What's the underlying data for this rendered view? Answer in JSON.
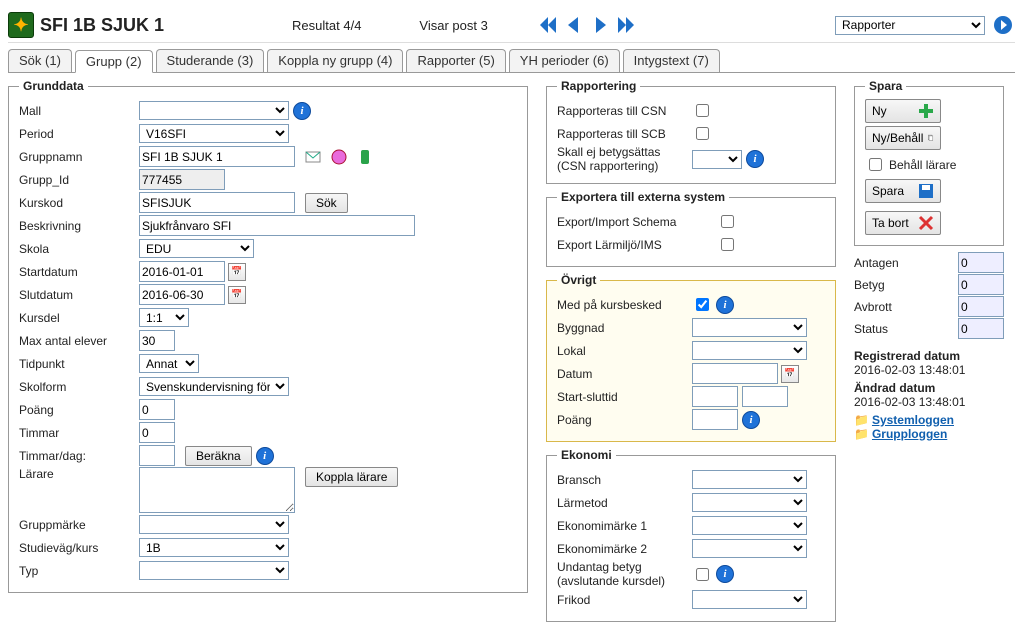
{
  "header": {
    "title": "SFI 1B SJUK 1",
    "result": "Resultat 4/4",
    "view_post": "Visar post 3",
    "report_select": "Rapporter"
  },
  "tabs": [
    {
      "label": "Sök (1)",
      "active": false
    },
    {
      "label": "Grupp (2)",
      "active": true
    },
    {
      "label": "Studerande (3)",
      "active": false
    },
    {
      "label": "Koppla ny grupp (4)",
      "active": false
    },
    {
      "label": "Rapporter (5)",
      "active": false
    },
    {
      "label": "YH perioder (6)",
      "active": false
    },
    {
      "label": "Intygstext (7)",
      "active": false
    }
  ],
  "grunddata": {
    "legend": "Grunddata",
    "mall_label": "Mall",
    "mall_value": "",
    "period_label": "Period",
    "period_value": "V16SFI",
    "gruppnamn_label": "Gruppnamn",
    "gruppnamn_value": "SFI 1B SJUK 1",
    "gruppid_label": "Grupp_Id",
    "gruppid_value": "777455",
    "kurskod_label": "Kurskod",
    "kurskod_value": "SFISJUK",
    "sok_label": "Sök",
    "beskrivning_label": "Beskrivning",
    "beskrivning_value": "Sjukfrånvaro SFI",
    "skola_label": "Skola",
    "skola_value": "EDU",
    "startdatum_label": "Startdatum",
    "startdatum_value": "2016-01-01",
    "slutdatum_label": "Slutdatum",
    "slutdatum_value": "2016-06-30",
    "kursdel_label": "Kursdel",
    "kursdel_value": "1:1",
    "maxantal_label": "Max antal elever",
    "maxantal_value": "30",
    "tidpunkt_label": "Tidpunkt",
    "tidpunkt_value": "Annat",
    "skolform_label": "Skolform",
    "skolform_value": "Svenskundervisning för in",
    "poang_label": "Poäng",
    "poang_value": "0",
    "timmar_label": "Timmar",
    "timmar_value": "0",
    "timmardag_label": "Timmar/dag:",
    "timmardag_value": "",
    "berakna_label": "Beräkna",
    "larare_label": "Lärare",
    "koppla_larare_label": "Koppla lärare",
    "gruppmarke_label": "Gruppmärke",
    "gruppmarke_value": "",
    "studievag_label": "Studieväg/kurs",
    "studievag_value": "1B",
    "typ_label": "Typ",
    "typ_value": ""
  },
  "rapportering": {
    "legend": "Rapportering",
    "csn_label": "Rapporteras till CSN",
    "scb_label": "Rapporteras till SCB",
    "betyg_label1": "Skall ej betygsättas",
    "betyg_label2": "(CSN rapportering)"
  },
  "exportera": {
    "legend": "Exportera till externa system",
    "schema_label": "Export/Import Schema",
    "larmiljo_label": "Export Lärmiljö/IMS"
  },
  "ovrigt": {
    "legend": "Övrigt",
    "kursbesked_label": "Med på kursbesked",
    "byggnad_label": "Byggnad",
    "lokal_label": "Lokal",
    "datum_label": "Datum",
    "startslut_label": "Start-sluttid",
    "poang_label": "Poäng"
  },
  "ekonomi": {
    "legend": "Ekonomi",
    "bransch_label": "Bransch",
    "larmetod_label": "Lärmetod",
    "em1_label": "Ekonomimärke 1",
    "em2_label": "Ekonomimärke 2",
    "undantag_label1": "Undantag betyg",
    "undantag_label2": "(avslutande kursdel)",
    "frikod_label": "Frikod"
  },
  "spara": {
    "legend": "Spara",
    "ny_label": "Ny",
    "nybehall_label": "Ny/Behåll",
    "behall_larare_label": "Behåll lärare",
    "spara_label": "Spara",
    "tabort_label": "Ta bort"
  },
  "stats": {
    "antagen_label": "Antagen",
    "antagen_value": "0",
    "betyg_label": "Betyg",
    "betyg_value": "0",
    "avbrott_label": "Avbrott",
    "avbrott_value": "0",
    "status_label": "Status",
    "status_value": "0"
  },
  "meta": {
    "reg_title": "Registrerad datum",
    "reg_value": "2016-02-03 13:48:01",
    "mod_title": "Ändrad datum",
    "mod_value": "2016-02-03 13:48:01",
    "syslog": "Systemloggen",
    "grplog": "Grupploggen"
  }
}
